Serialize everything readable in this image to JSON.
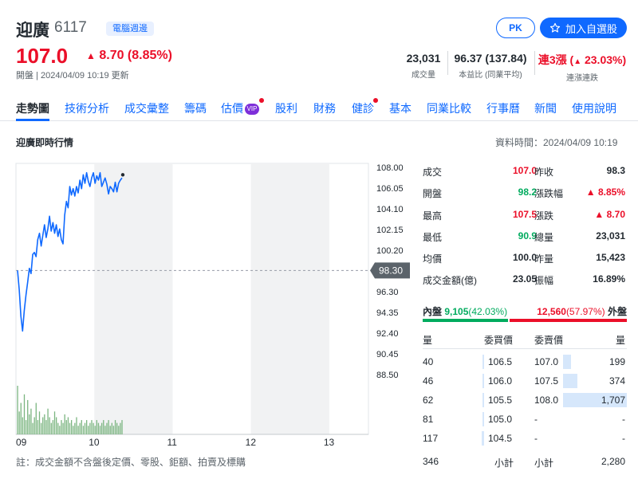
{
  "header": {
    "name": "迎廣",
    "code": "6117",
    "badge": "電腦週邊",
    "pk_label": "PK",
    "add_label": "加入自選股",
    "price": "107.0",
    "change": "8.70 (8.85%)",
    "open_time": "開盤 | 2024/04/09 10:19 更新",
    "stats": [
      {
        "value": "23,031",
        "label": "成交量"
      },
      {
        "value": "96.37 (137.84)",
        "label": "本益比 (同業平均)"
      },
      {
        "value_prefix": "連3漲 (",
        "value_arrow": "▲",
        "value_rest": "23.03%)",
        "label": "連漲連跌"
      }
    ]
  },
  "nav": {
    "items": [
      "走勢圖",
      "技術分析",
      "成交彙整",
      "籌碼",
      "估價",
      "股利",
      "財務",
      "健診",
      "基本",
      "同業比較",
      "行事曆",
      "新聞",
      "使用說明"
    ],
    "vip": "VIP"
  },
  "section": {
    "title": "迎廣即時行情",
    "data_time": "資料時間：2024/04/09 10:19"
  },
  "chart_data": {
    "type": "line",
    "title": "",
    "xlabel": "",
    "ylabel": "",
    "x_ticks": [
      "09",
      "10",
      "11",
      "12",
      "13"
    ],
    "y_ticks": [
      "108.00",
      "106.05",
      "104.10",
      "102.15",
      "100.20",
      "98.30",
      "96.30",
      "94.35",
      "92.40",
      "90.45",
      "88.50"
    ],
    "ylim": [
      88.5,
      108.0
    ],
    "reference_price": "98.30",
    "series": [
      {
        "values": [
          98.3,
          96.5,
          94.0,
          92.6,
          94.5,
          96.0,
          97.2,
          98.5,
          98.0,
          99.8,
          100.0,
          99.6,
          101.2,
          101.8,
          100.6,
          101.6,
          102.6,
          101.4,
          102.2,
          103.4,
          102.0,
          102.8,
          101.8,
          102.6,
          101.5,
          102.2,
          101.2,
          100.8,
          103.5,
          104.8,
          104.2,
          106.2,
          105.4,
          106.0,
          105.3,
          106.2,
          105.6,
          106.8,
          106.0,
          107.3,
          106.5,
          107.5,
          106.7,
          106.2,
          107.0,
          107.5,
          106.5,
          107.2,
          106.8,
          107.5,
          106.2,
          106.6,
          107.0,
          106.4,
          105.5,
          106.2,
          106.0,
          105.7,
          106.6,
          105.7,
          106.5,
          106.8,
          107.0
        ],
        "color": "#0f69ff"
      }
    ],
    "volume": [
      85,
      40,
      55,
      30,
      70,
      25,
      60,
      35,
      45,
      20,
      30,
      55,
      25,
      40,
      20,
      30,
      35,
      25,
      45,
      30,
      20,
      25,
      40,
      30,
      20,
      15,
      25,
      20,
      35,
      25,
      30,
      20,
      25,
      15,
      20,
      30,
      15,
      20,
      25,
      15,
      20,
      25,
      15,
      20,
      25,
      20,
      15,
      25,
      20,
      15,
      20,
      25,
      15,
      20,
      25,
      15,
      20,
      15,
      25,
      20,
      15,
      20,
      25
    ],
    "volume_max": 85,
    "volume_color": "#7bb580",
    "last_point_color": "#232a31"
  },
  "quote": {
    "left": [
      {
        "label": "成交",
        "value": "107.0",
        "tone": "red"
      },
      {
        "label": "開盤",
        "value": "98.2",
        "tone": "green"
      },
      {
        "label": "最高",
        "value": "107.5",
        "tone": "red"
      },
      {
        "label": "最低",
        "value": "90.9",
        "tone": "green"
      },
      {
        "label": "均價",
        "value": "100.0",
        "tone": "dark"
      },
      {
        "label": "成交金額(億)",
        "value": "23.05",
        "tone": "dark"
      }
    ],
    "right": [
      {
        "label": "昨收",
        "value": "98.3",
        "tone": "dark"
      },
      {
        "label": "漲跌幅",
        "value": "▲ 8.85%",
        "tone": "red"
      },
      {
        "label": "漲跌",
        "value": "▲ 8.70",
        "tone": "red"
      },
      {
        "label": "總量",
        "value": "23,031",
        "tone": "dark"
      },
      {
        "label": "昨量",
        "value": "15,423",
        "tone": "dark"
      },
      {
        "label": "振幅",
        "value": "16.89%",
        "tone": "dark"
      }
    ]
  },
  "inout": {
    "in_label": "內盤",
    "in_value": "9,105",
    "in_pct": "(42.03%)",
    "out_value": "12,560",
    "out_pct": "(57.97%)",
    "out_label": "外盤",
    "in_ratio": 0.4203
  },
  "orderbook": {
    "headers": {
      "bid_vol": "量",
      "bid_price": "委買價",
      "ask_price": "委賣價",
      "ask_vol": "量"
    },
    "bids": [
      {
        "vol": "40",
        "price": "106.5",
        "level": 0.08
      },
      {
        "vol": "46",
        "price": "106.0",
        "level": 0.08
      },
      {
        "vol": "62",
        "price": "105.5",
        "level": 0.08
      },
      {
        "vol": "81",
        "price": "105.0",
        "level": 0.08
      },
      {
        "vol": "117",
        "price": "104.5",
        "level": 0.1
      }
    ],
    "asks": [
      {
        "vol": "199",
        "price": "107.0",
        "level": 0.12
      },
      {
        "vol": "374",
        "price": "107.5",
        "level": 0.22
      },
      {
        "vol": "1,707",
        "price": "108.0",
        "level": 1.0
      },
      {
        "vol": "-",
        "price": "-",
        "level": 0
      },
      {
        "vol": "-",
        "price": "-",
        "level": 0
      }
    ],
    "bid_total": "346",
    "bid_total_label": "小計",
    "ask_total_label": "小計",
    "ask_total": "2,280"
  },
  "footnote": "註：成交金額不含盤後定價、零股、鉅額、拍賣及標購"
}
